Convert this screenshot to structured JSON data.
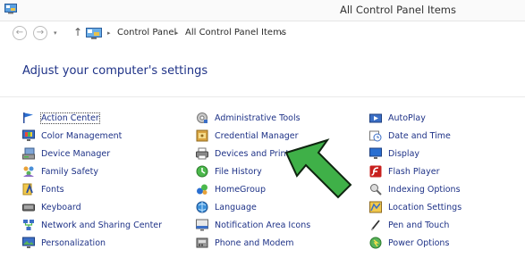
{
  "window": {
    "title": "All Control Panel Items"
  },
  "nav": {
    "back_glyph": "←",
    "forward_glyph": "→",
    "dropdown_glyph": "▾",
    "up_glyph": "↑",
    "separator": "▸",
    "breadcrumbs": [
      "Control Panel",
      "All Control Panel Items"
    ]
  },
  "main": {
    "heading": "Adjust your computer's settings",
    "columns": [
      {
        "items": [
          {
            "label": "Action Center",
            "icon": "flag-icon"
          },
          {
            "label": "Color Management",
            "icon": "monitor-color-icon"
          },
          {
            "label": "Device Manager",
            "icon": "device-manager-icon"
          },
          {
            "label": "Family Safety",
            "icon": "family-safety-icon"
          },
          {
            "label": "Fonts",
            "icon": "fonts-icon"
          },
          {
            "label": "Keyboard",
            "icon": "keyboard-icon"
          },
          {
            "label": "Network and Sharing Center",
            "icon": "network-icon"
          },
          {
            "label": "Personalization",
            "icon": "personalization-icon"
          }
        ]
      },
      {
        "items": [
          {
            "label": "Administrative Tools",
            "icon": "admin-tools-icon"
          },
          {
            "label": "Credential Manager",
            "icon": "credential-icon"
          },
          {
            "label": "Devices and Printers",
            "icon": "printer-icon"
          },
          {
            "label": "File History",
            "icon": "file-history-icon"
          },
          {
            "label": "HomeGroup",
            "icon": "homegroup-icon"
          },
          {
            "label": "Language",
            "icon": "language-icon"
          },
          {
            "label": "Notification Area Icons",
            "icon": "notification-icon"
          },
          {
            "label": "Phone and Modem",
            "icon": "phone-modem-icon"
          }
        ]
      },
      {
        "items": [
          {
            "label": "AutoPlay",
            "icon": "autoplay-icon"
          },
          {
            "label": "Date and Time",
            "icon": "clock-icon"
          },
          {
            "label": "Display",
            "icon": "display-icon"
          },
          {
            "label": "Flash Player",
            "icon": "flash-icon"
          },
          {
            "label": "Indexing Options",
            "icon": "indexing-icon"
          },
          {
            "label": "Location Settings",
            "icon": "location-icon"
          },
          {
            "label": "Pen and Touch",
            "icon": "pen-icon"
          },
          {
            "label": "Power Options",
            "icon": "power-icon"
          }
        ]
      }
    ]
  },
  "colors": {
    "link": "#1e3287",
    "arrow_fill": "#3fb048",
    "arrow_stroke": "#0f2410"
  }
}
